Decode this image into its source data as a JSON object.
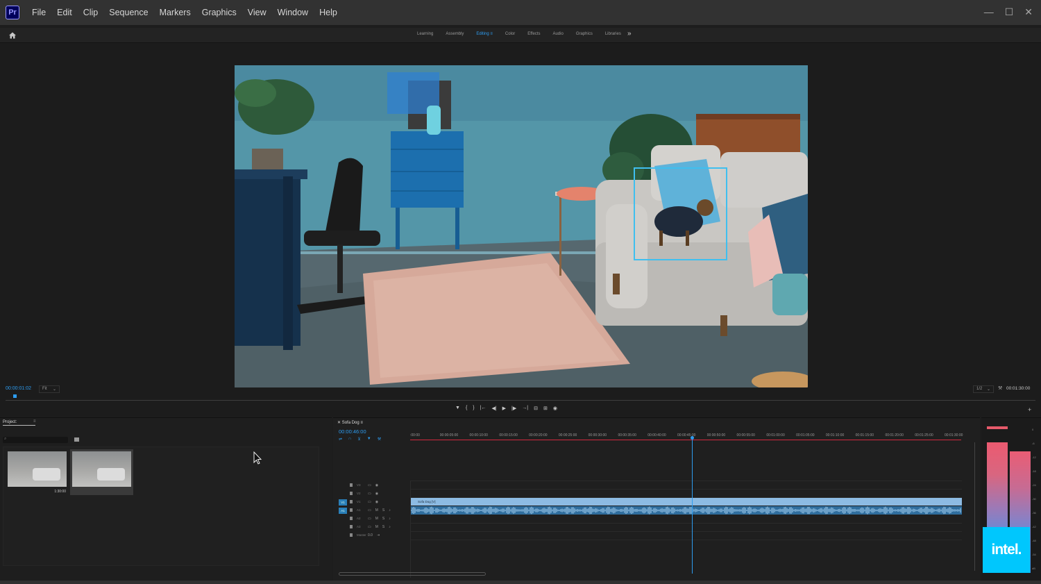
{
  "app": {
    "logo_text": "Pr"
  },
  "menu": {
    "items": [
      "File",
      "Edit",
      "Clip",
      "Sequence",
      "Markers",
      "Graphics",
      "View",
      "Window",
      "Help"
    ]
  },
  "window_controls": {
    "minimize": "—",
    "maximize": "☐",
    "close": "✕"
  },
  "workspaces": {
    "tabs": [
      "Learning",
      "Assembly",
      "Editing",
      "Color",
      "Effects",
      "Audio",
      "Graphics",
      "Libraries"
    ],
    "active": "Editing",
    "active_menu_glyph": "≡",
    "more": "»"
  },
  "program_monitor": {
    "timecode": "00:00:01:02",
    "fit": "Fit",
    "resolution": "1/2",
    "duration": "00:01:30:00",
    "transport": [
      "▼",
      "{",
      "}",
      "|←",
      "◀|",
      "▶",
      "|▶",
      "→|",
      "⊟",
      "⊞",
      "◉"
    ],
    "add_button": "+"
  },
  "project": {
    "tab_label": "Project:",
    "tab_menu": "≡",
    "search_icon": "⌕",
    "items": [
      {
        "duration": "1:30:00",
        "selected": false
      },
      {
        "duration": "",
        "selected": true
      }
    ]
  },
  "timeline": {
    "tab_label": "Sofa Dog",
    "tab_menu": "≡",
    "timecode": "00:00:46:00",
    "tools": [
      "⇌",
      "∩",
      "⊻",
      "▼",
      "⚒"
    ],
    "ruler_labels": [
      ":00:00",
      "00:00:05:00",
      "00:00:10:00",
      "00:00:15:00",
      "00:00:20:00",
      "00:00:25:00",
      "00:00:30:00",
      "00:00:35:00",
      "00:00:40:00",
      "00:00:45:00",
      "00:00:50:00",
      "00:00:55:00",
      "00:01:00:00",
      "00:01:05:00",
      "00:01:10:00",
      "00:01:15:00",
      "00:01:20:00",
      "00:01:25:00",
      "00:01:30:00"
    ],
    "tracks": [
      {
        "name": "V3",
        "toggle": "",
        "btns": [
          "▭",
          "◉"
        ]
      },
      {
        "name": "V2",
        "toggle": "",
        "btns": [
          "▭",
          "◉"
        ]
      },
      {
        "name": "V1",
        "toggle": "V1",
        "btns": [
          "▭",
          "◉"
        ]
      },
      {
        "name": "A1",
        "toggle": "A1",
        "btns": [
          "▭",
          "M",
          "S",
          "♪"
        ]
      },
      {
        "name": "A2",
        "toggle": "",
        "btns": [
          "▭",
          "M",
          "S",
          "♪"
        ]
      },
      {
        "name": "A3",
        "toggle": "",
        "btns": [
          "▭",
          "M",
          "S",
          "♪"
        ]
      },
      {
        "name": "Master",
        "toggle": "",
        "btns": [
          "0.0",
          "⇥"
        ]
      }
    ],
    "video_clip_label": "Sofa Dog [V]",
    "playhead_fraction": 0.511
  },
  "audio_meter": {
    "scale": [
      "0",
      "-6",
      "-12",
      "-18",
      "-24",
      "-30",
      "-36",
      "-42",
      "-48",
      "-54",
      "dB"
    ]
  },
  "intel": {
    "text": "intel."
  },
  "colors": {
    "accent": "#2d9cf0",
    "ruler_red": "#d1293f",
    "meter_top": "#ec5a70"
  }
}
